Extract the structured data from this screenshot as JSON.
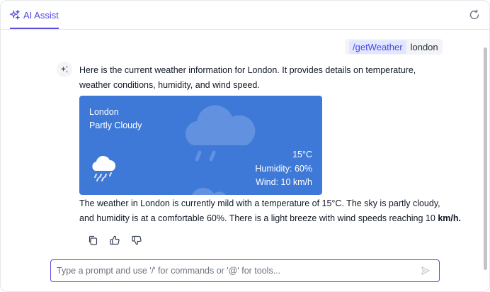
{
  "header": {
    "tab_label": "AI Assist",
    "tab_icon": "sparkles-icon",
    "refresh_icon": "refresh-icon"
  },
  "user_message": {
    "command": "/getWeather",
    "text": "london"
  },
  "bot_message": {
    "intro_line1": "Here is the current weather information for London. It provides details on temperature,",
    "intro_line2": "weather conditions, humidity, and wind speed.",
    "summary_line1": "The weather in London is currently mild with a temperature of 15°C. The sky is partly cloudy,",
    "summary_line2_prefix": "and humidity is at a comfortable 60%. There is a light breeze with wind speeds reaching 10 ",
    "summary_line2_bold": "km/h."
  },
  "weather_card": {
    "city": "London",
    "condition": "Partly Cloudy",
    "temperature": "15°C",
    "humidity": "Humidity: 60%",
    "wind": "Wind: 10 km/h",
    "icon": "rain-cloud-icon",
    "background_color": "#3e79d8"
  },
  "actions": {
    "copy_icon": "copy-icon",
    "like_icon": "thumbs-up-icon",
    "dislike_icon": "thumbs-down-icon"
  },
  "input": {
    "value": "",
    "placeholder": "Type a prompt and use '/' for commands or '@' for tools...",
    "send_icon": "send-icon"
  },
  "colors": {
    "accent": "#5b4fdb",
    "chip_bg": "#e0e7ff",
    "chip_text": "#4f46e5"
  }
}
